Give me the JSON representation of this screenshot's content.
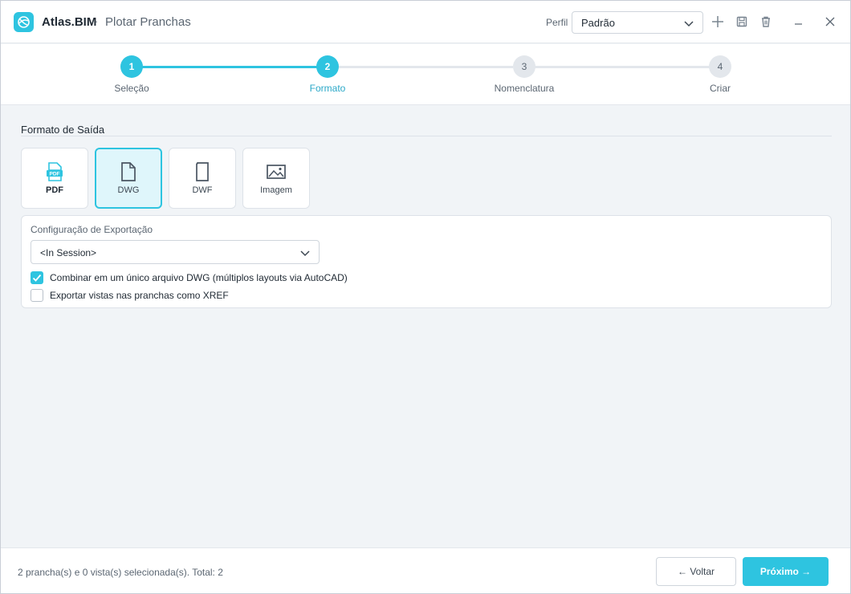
{
  "app": {
    "name": "Atlas.BIM",
    "separator": "·",
    "title": "Plotar Pranchas",
    "logo_icon": "atlas-globe-logo",
    "brand_color": "#2ec4e0"
  },
  "header": {
    "profile_label": "Perfil",
    "profile_value": "Padrão",
    "icons": [
      "plus-icon",
      "save-icon",
      "trash-icon",
      "minimize-icon",
      "close-icon"
    ]
  },
  "stepper": {
    "steps": [
      {
        "number": "1",
        "label": "Seleção",
        "state": "done"
      },
      {
        "number": "2",
        "label": "Formato",
        "state": "current"
      },
      {
        "number": "3",
        "label": "Nomenclatura",
        "state": "pending"
      },
      {
        "number": "4",
        "label": "Criar",
        "state": "pending"
      }
    ]
  },
  "output": {
    "section_title": "Formato de Saída",
    "formats": [
      {
        "label": "PDF",
        "icon": "pdf-file-icon",
        "selected": false
      },
      {
        "label": "DWG",
        "icon": "dwg-file-icon",
        "selected": true
      },
      {
        "label": "DWF",
        "icon": "dwf-file-icon",
        "selected": false
      },
      {
        "label": "Imagem",
        "icon": "image-icon",
        "selected": false
      }
    ]
  },
  "export_config": {
    "label": "Configuração de Exportação",
    "selected_setup": "<In Session>",
    "options": [
      {
        "label": "Combinar em um único arquivo DWG (múltiplos layouts via AutoCAD)",
        "checked": true
      },
      {
        "label": "Exportar vistas nas pranchas como XREF",
        "checked": false
      }
    ]
  },
  "footer": {
    "status": "2 prancha(s) e 0 vista(s) selecionada(s). Total: 2",
    "back_label": "← Voltar",
    "next_label": "Próximo →"
  }
}
